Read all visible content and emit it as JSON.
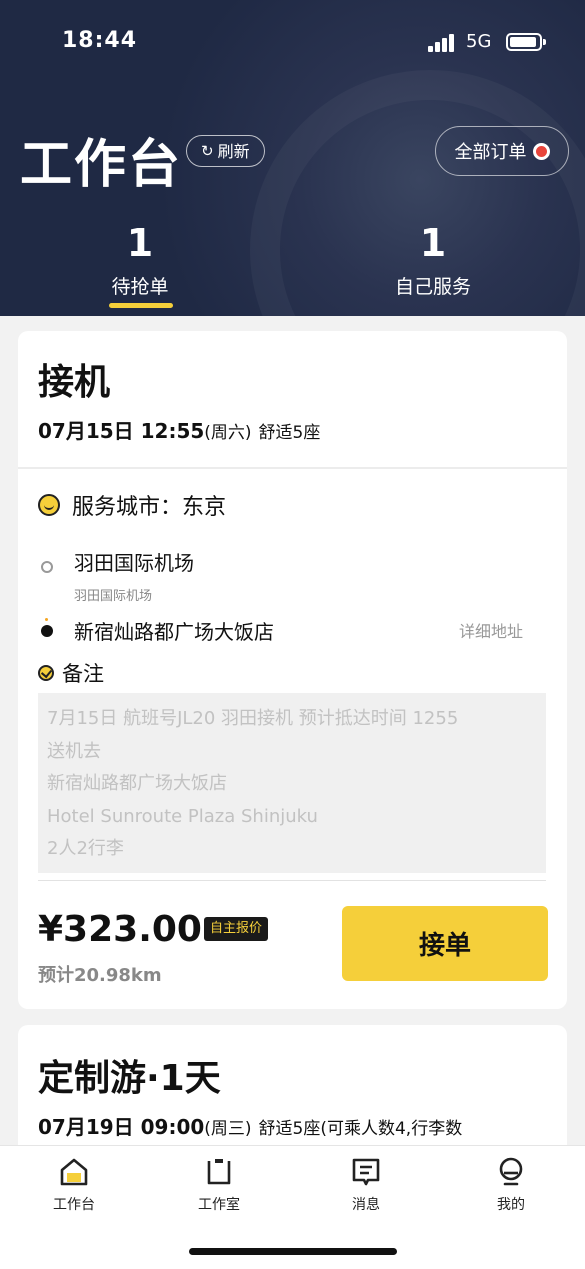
{
  "status_bar": {
    "time": "18:44",
    "network": "5G"
  },
  "header": {
    "title": "工作台",
    "refresh_label": "刷新",
    "all_orders_label": "全部订单",
    "tabs": [
      {
        "count": "1",
        "label": "待抢单"
      },
      {
        "count": "1",
        "label": "自己服务"
      }
    ]
  },
  "order1": {
    "type": "接机",
    "date": "07月15日 12:55",
    "weekday": "(周六)",
    "car": "舒适5座",
    "city": "服务城市：东京",
    "from_name": "羽田国际机场",
    "from_sub": "羽田国际机场",
    "to_name": "新宿灿路都广场大饭店",
    "detail_address": "详细地址",
    "remark_label": "备注",
    "remark_lines": [
      "7月15日 航班号JL20 羽田接机 预计抵达时间 1255",
      "送机去",
      "新宿灿路都广场大饭店",
      "Hotel Sunroute Plaza Shinjuku",
      "2人2行李"
    ],
    "price": "¥323.00",
    "price_tag": "自主报价",
    "estimate": "预计20.98km",
    "accept_label": "接单"
  },
  "order2": {
    "type": "定制游·1天",
    "date": "07月19日 09:00",
    "weekday": "(周三)",
    "car": "舒适5座(可乘人数4,行李数"
  },
  "nav": [
    {
      "label": "工作台",
      "icon": "home-icon"
    },
    {
      "label": "工作室",
      "icon": "studio-icon"
    },
    {
      "label": "消息",
      "icon": "message-icon"
    },
    {
      "label": "我的",
      "icon": "profile-icon"
    }
  ],
  "colors": {
    "header_bg": "#1f2944",
    "accent": "#f5cf3a",
    "alert": "#e8453c"
  }
}
